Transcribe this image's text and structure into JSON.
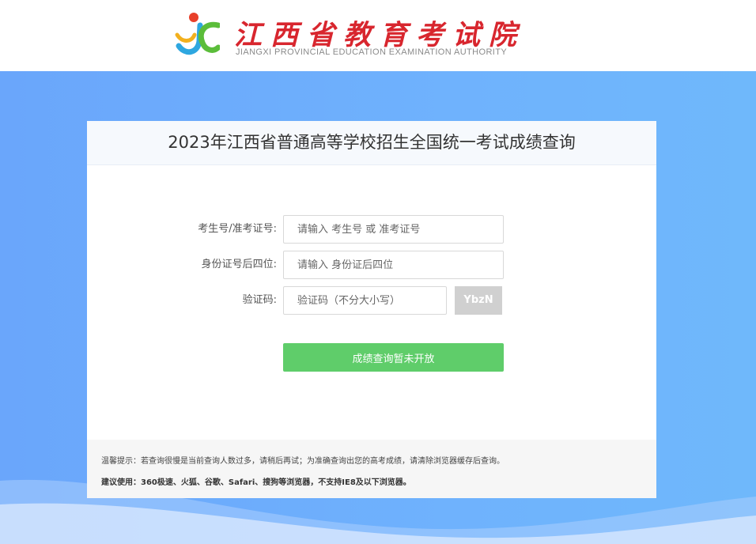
{
  "header": {
    "logo_cn": "江西省教育考试院",
    "logo_en": "JIANGXI PROVINCIAL EDUCATION EXAMINATION AUTHORITY"
  },
  "form": {
    "title": "2023年江西省普通高等学校招生全国统一考试成绩查询",
    "exam_number": {
      "label": "考生号/准考证号:",
      "placeholder": "请输入 考生号 或 准考证号"
    },
    "id_last4": {
      "label": "身份证号后四位:",
      "placeholder": "请输入 身份证后四位"
    },
    "captcha": {
      "label": "验证码:",
      "placeholder": "验证码（不分大小写）",
      "code": "YbzN"
    },
    "submit_label": "成绩查询暂未开放"
  },
  "notice": {
    "tip": "温馨提示：若查询很慢是当前查询人数过多，请稍后再试；为准确查询出您的高考成绩，请清除浏览器缓存后查询。",
    "browsers": "建议使用：360极速、火狐、谷歌、Safari、搜狗等浏览器，不支持IE8及以下浏览器。"
  },
  "colors": {
    "background_blue": "#6aa6fb",
    "submit_green": "#5fcd6a",
    "logo_red": "#d8262e"
  }
}
